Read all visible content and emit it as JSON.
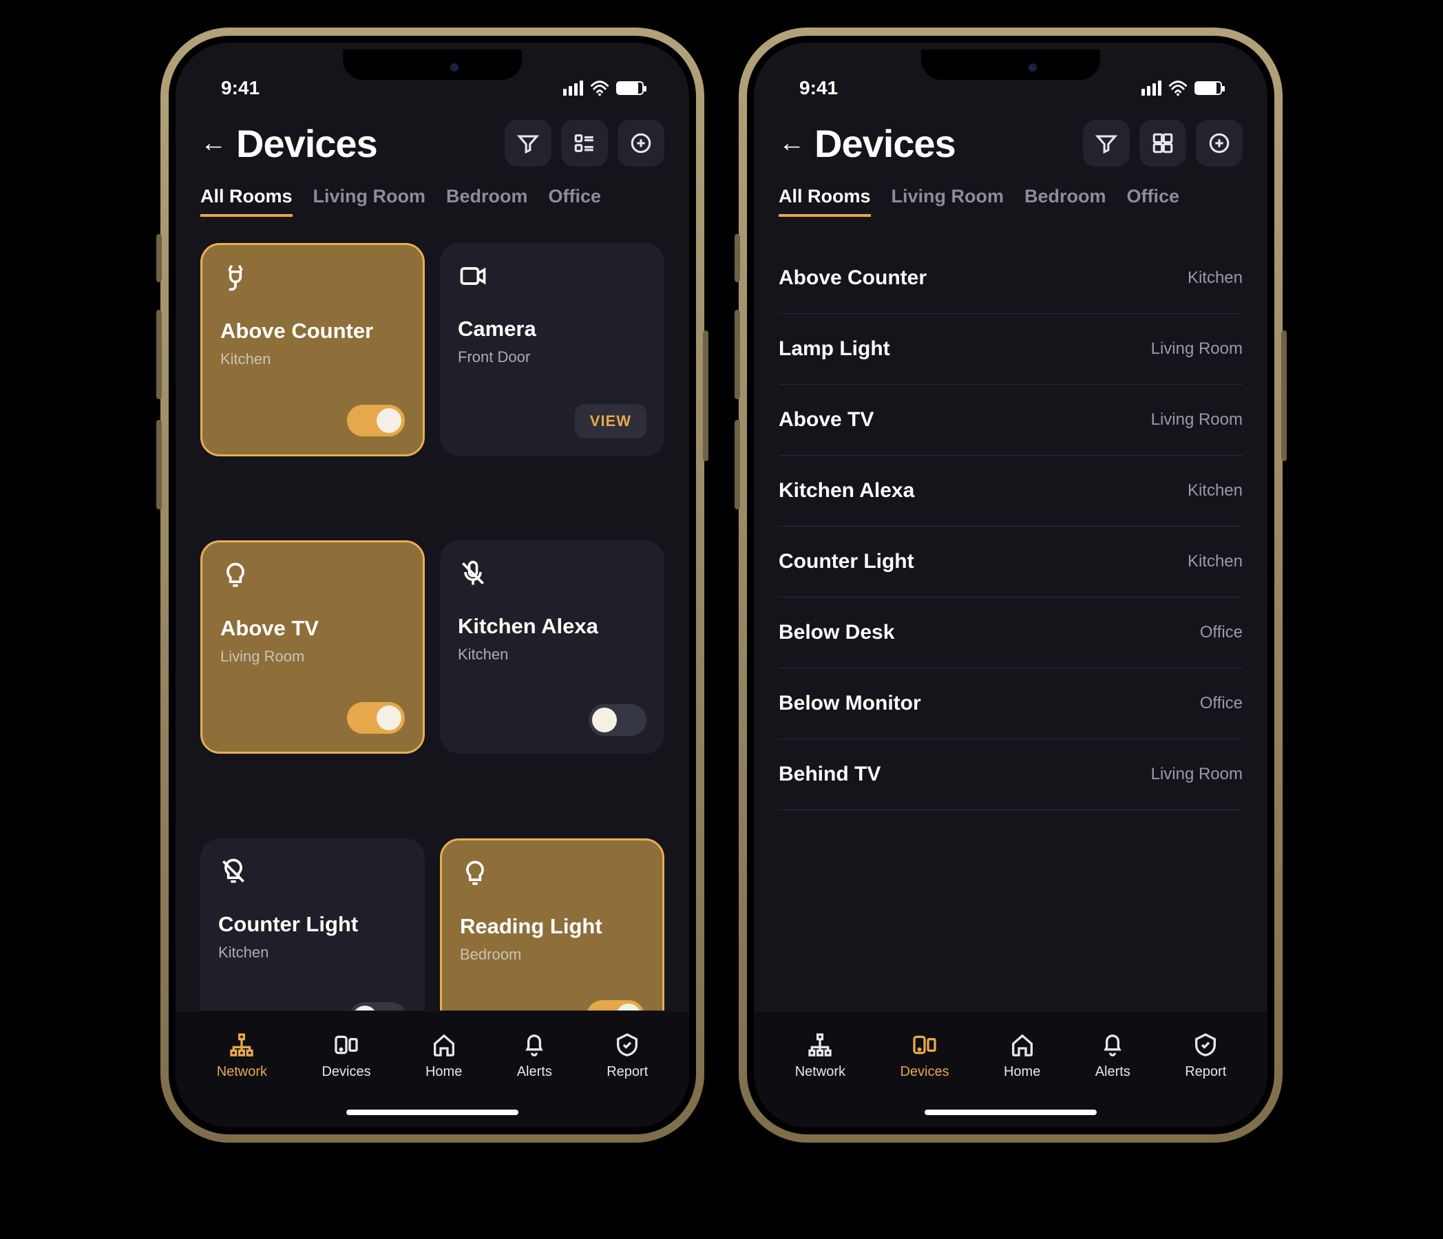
{
  "status": {
    "time": "9:41"
  },
  "header": {
    "title": "Devices"
  },
  "tabs": [
    "All Rooms",
    "Living Room",
    "Bedroom",
    "Office"
  ],
  "active_tab": 0,
  "grid_devices": [
    {
      "name": "Above Counter",
      "room": "Kitchen",
      "type": "plug",
      "on": true
    },
    {
      "name": "Camera",
      "room": "Front Door",
      "type": "camera",
      "on": null,
      "action": "VIEW"
    },
    {
      "name": "Above TV",
      "room": "Living Room",
      "type": "light",
      "on": true
    },
    {
      "name": "Kitchen Alexa",
      "room": "Kitchen",
      "type": "mic",
      "on": false
    },
    {
      "name": "Counter Light",
      "room": "Kitchen",
      "type": "light-off",
      "on": false
    },
    {
      "name": "Reading Light",
      "room": "Bedroom",
      "type": "light",
      "on": true
    }
  ],
  "list_devices": [
    {
      "name": "Above Counter",
      "room": "Kitchen"
    },
    {
      "name": "Lamp Light",
      "room": "Living Room"
    },
    {
      "name": "Above TV",
      "room": "Living Room"
    },
    {
      "name": "Kitchen Alexa",
      "room": "Kitchen"
    },
    {
      "name": "Counter Light",
      "room": "Kitchen"
    },
    {
      "name": "Below Desk",
      "room": "Office"
    },
    {
      "name": "Below Monitor",
      "room": "Office"
    },
    {
      "name": "Behind TV",
      "room": "Living Room"
    }
  ],
  "nav": [
    {
      "label": "Network"
    },
    {
      "label": "Devices"
    },
    {
      "label": "Home"
    },
    {
      "label": "Alerts"
    },
    {
      "label": "Report"
    }
  ],
  "nav_active_left": 0,
  "nav_active_right": 1,
  "colors": {
    "accent": "#e6a84a",
    "card_on": "#8e6f3a",
    "bg": "#14141a"
  }
}
